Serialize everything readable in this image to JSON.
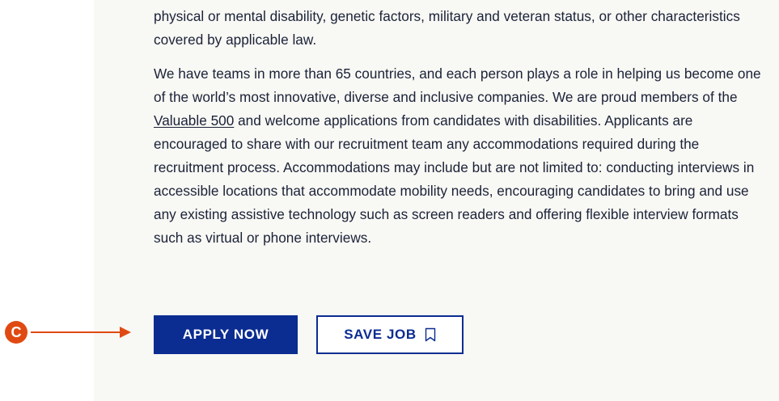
{
  "body": {
    "paragraph1": "physical or mental disability, genetic factors, military and veteran status, or other characteristics covered by applicable law.",
    "paragraph2_before_link": "We have teams in more than 65 countries, and each person plays a role in helping us become one of the world’s most innovative, diverse and inclusive companies. We are proud members of the ",
    "link_text": "Valuable 500",
    "paragraph2_after_link": " and welcome applications from candidates with disabilities. Applicants are encouraged to share with our recruitment team any accommodations required during the recruitment process. Accommodations may include but are not limited to: conducting interviews in accessible locations that accommodate mobility needs, encouraging candidates to bring and use any existing assistive technology such as screen readers and offering flexible interview formats such as virtual or phone interviews."
  },
  "actions": {
    "apply_label": "APPLY NOW",
    "save_label": "SAVE JOB",
    "save_icon": "bookmark-icon"
  },
  "annotation": {
    "marker_label": "C",
    "marker_color": "#e04a12",
    "arrow_icon": "arrow-right-icon"
  },
  "colors": {
    "brand_blue": "#0b2c91",
    "text": "#1b2238",
    "panel_background": "#f8f8f4"
  }
}
